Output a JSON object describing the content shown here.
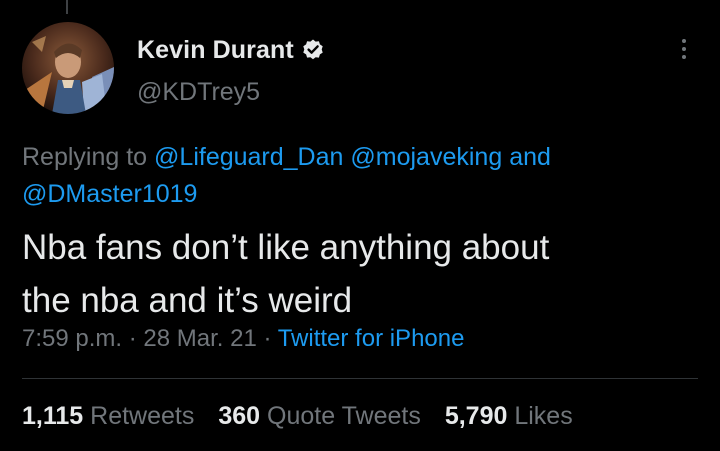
{
  "author": {
    "display_name": "Kevin Durant",
    "handle": "@KDTrey5",
    "verified": true
  },
  "replying": {
    "prefix": "Replying to ",
    "mentions": [
      "@Lifeguard_Dan",
      "@mojaveking",
      "@DMaster1019"
    ],
    "conjunction": "and"
  },
  "tweet": {
    "text_line1": "Nba fans don’t like anything about",
    "text_line2": "the nba and it’s weird"
  },
  "meta": {
    "time": "7:59 p.m.",
    "separator": " · ",
    "date": "28 Mar. 21",
    "source": "Twitter for iPhone"
  },
  "stats": {
    "retweets_count": "1,115",
    "retweets_label": "Retweets",
    "quote_count": "360",
    "quote_label": "Quote Tweets",
    "likes_count": "5,790",
    "likes_label": "Likes"
  },
  "icons": {
    "verified": "verified-badge-icon",
    "more": "more-options-icon"
  },
  "colors": {
    "background": "#000000",
    "primary_text": "#e7e9ea",
    "secondary_text": "#71767b",
    "link": "#1d9bf0",
    "divider": "#2f3336"
  }
}
